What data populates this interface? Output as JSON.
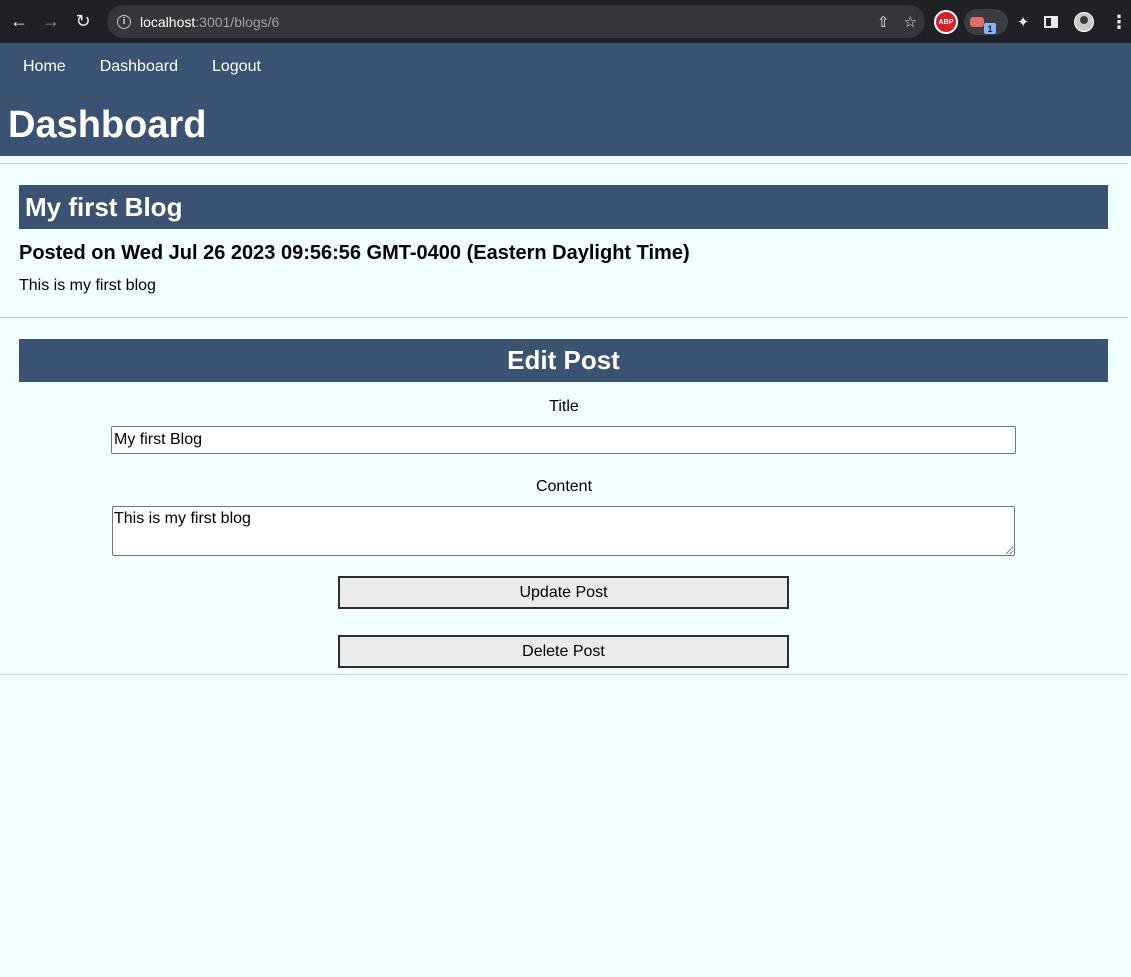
{
  "browser": {
    "url_host": "localhost",
    "url_path": ":3001/blogs/6",
    "extension_badge": "1",
    "abp_label": "ABP"
  },
  "nav": {
    "items": [
      {
        "label": "Home"
      },
      {
        "label": "Dashboard"
      },
      {
        "label": "Logout"
      }
    ]
  },
  "header": {
    "title": "Dashboard"
  },
  "post": {
    "title": "My first Blog",
    "posted_on": "Posted on Wed Jul 26 2023 09:56:56 GMT-0400 (Eastern Daylight Time)",
    "content": "This is my first blog"
  },
  "edit_form": {
    "heading": "Edit Post",
    "title_label": "Title",
    "title_value": "My first Blog",
    "content_label": "Content",
    "content_value": "This is my first blog",
    "update_label": "Update Post",
    "delete_label": "Delete Post"
  },
  "colors": {
    "header_bg": "#3a5373",
    "page_bg": "#f0ffff"
  }
}
